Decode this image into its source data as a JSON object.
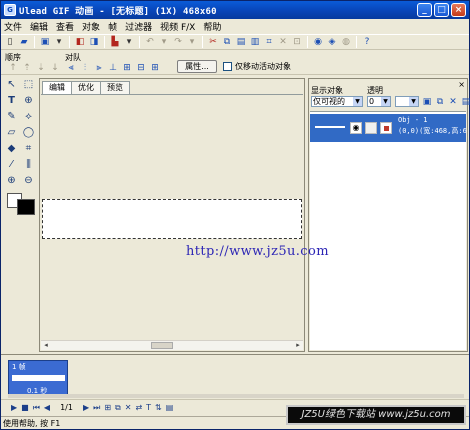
{
  "window": {
    "title": "Ulead GIF 动画 - [无标题] (1X) 468x60"
  },
  "menu": [
    "文件",
    "编辑",
    "查看",
    "对象",
    "帧",
    "过滤器",
    "视频 F/X",
    "帮助"
  ],
  "toolbar": {
    "icons": [
      "new-icon",
      "open-icon",
      "save-icon",
      "import-icon",
      "export-icon",
      "color-icon",
      "undo-icon",
      "redo-icon",
      "cut-icon",
      "copy-icon",
      "paste-icon",
      "duplicate-icon",
      "delete-icon",
      "preview-icon",
      "optimize-icon",
      "help-icon"
    ]
  },
  "toolbar2": {
    "order_label": "顺序",
    "align_label": "对队",
    "attr_button": "属性...",
    "move_checkbox": "仅移动活动对象"
  },
  "tabs": [
    "编辑",
    "优化",
    "预览"
  ],
  "objpanel": {
    "show_label": "显示对象",
    "opacity_label": "透明",
    "show_select": "仅可视的",
    "opacity_value": "0",
    "object": {
      "name": "Obj - 1",
      "info": "(0,0)(宽:468,高:6"
    }
  },
  "url_overlay": "http://www.jz5u.com",
  "frame": {
    "number": "1 帧",
    "delay": "0.1 秒"
  },
  "playbar": {
    "page": "1/1"
  },
  "status": {
    "text": "使用帮助, 按 F1"
  },
  "watermark": "JZ5U绿色下载站 www.jz5u.com"
}
